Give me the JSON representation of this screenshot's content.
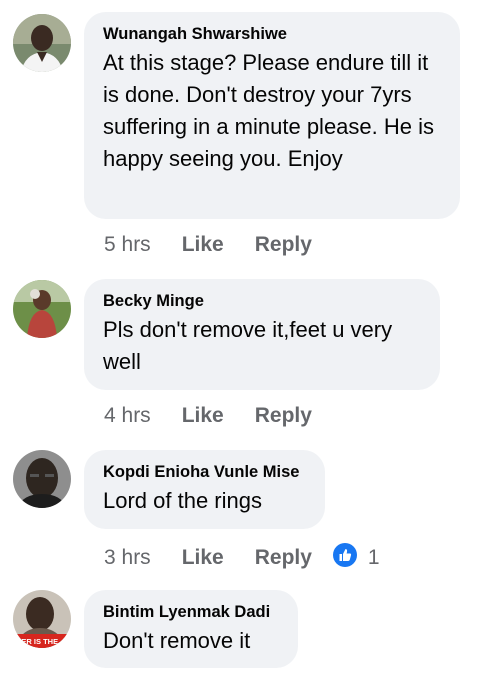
{
  "comments": [
    {
      "author": "Wunangah Shwarshiwe",
      "text": "At this stage? Please endure till it is done. Don't destroy your 7yrs suffering in a minute please. He is happy seeing you. Enjoy",
      "time": "5 hrs",
      "like": "Like",
      "reply": "Reply"
    },
    {
      "author": "Becky Minge",
      "text": "Pls don't remove it,feet u very well",
      "time": "4 hrs",
      "like": "Like",
      "reply": "Reply"
    },
    {
      "author": "Kopdi Enioha Vunle Mise",
      "text": "Lord of the rings",
      "time": "3 hrs",
      "like": "Like",
      "reply": "Reply",
      "reaction_count": "1"
    },
    {
      "author": "Bintim Lyenmak Dadi",
      "text": "Don't remove it",
      "avatar_caption": "KER IS THE"
    }
  ],
  "colors": {
    "bubble": "#f0f2f5",
    "meta_text": "#65676b",
    "like_reaction": "#1877f2"
  },
  "icons": [
    "like-reaction-icon"
  ]
}
